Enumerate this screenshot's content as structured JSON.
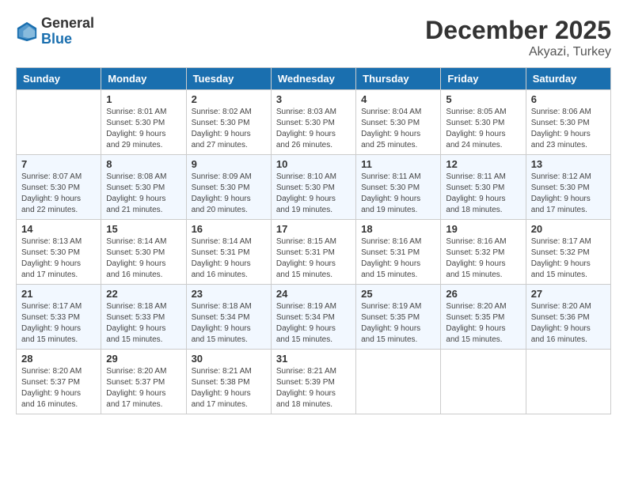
{
  "header": {
    "logo_line1": "General",
    "logo_line2": "Blue",
    "month": "December 2025",
    "location": "Akyazi, Turkey"
  },
  "weekdays": [
    "Sunday",
    "Monday",
    "Tuesday",
    "Wednesday",
    "Thursday",
    "Friday",
    "Saturday"
  ],
  "weeks": [
    [
      {
        "day": "",
        "sunrise": "",
        "sunset": "",
        "daylight": ""
      },
      {
        "day": "1",
        "sunrise": "Sunrise: 8:01 AM",
        "sunset": "Sunset: 5:30 PM",
        "daylight": "Daylight: 9 hours and 29 minutes."
      },
      {
        "day": "2",
        "sunrise": "Sunrise: 8:02 AM",
        "sunset": "Sunset: 5:30 PM",
        "daylight": "Daylight: 9 hours and 27 minutes."
      },
      {
        "day": "3",
        "sunrise": "Sunrise: 8:03 AM",
        "sunset": "Sunset: 5:30 PM",
        "daylight": "Daylight: 9 hours and 26 minutes."
      },
      {
        "day": "4",
        "sunrise": "Sunrise: 8:04 AM",
        "sunset": "Sunset: 5:30 PM",
        "daylight": "Daylight: 9 hours and 25 minutes."
      },
      {
        "day": "5",
        "sunrise": "Sunrise: 8:05 AM",
        "sunset": "Sunset: 5:30 PM",
        "daylight": "Daylight: 9 hours and 24 minutes."
      },
      {
        "day": "6",
        "sunrise": "Sunrise: 8:06 AM",
        "sunset": "Sunset: 5:30 PM",
        "daylight": "Daylight: 9 hours and 23 minutes."
      }
    ],
    [
      {
        "day": "7",
        "sunrise": "Sunrise: 8:07 AM",
        "sunset": "Sunset: 5:30 PM",
        "daylight": "Daylight: 9 hours and 22 minutes."
      },
      {
        "day": "8",
        "sunrise": "Sunrise: 8:08 AM",
        "sunset": "Sunset: 5:30 PM",
        "daylight": "Daylight: 9 hours and 21 minutes."
      },
      {
        "day": "9",
        "sunrise": "Sunrise: 8:09 AM",
        "sunset": "Sunset: 5:30 PM",
        "daylight": "Daylight: 9 hours and 20 minutes."
      },
      {
        "day": "10",
        "sunrise": "Sunrise: 8:10 AM",
        "sunset": "Sunset: 5:30 PM",
        "daylight": "Daylight: 9 hours and 19 minutes."
      },
      {
        "day": "11",
        "sunrise": "Sunrise: 8:11 AM",
        "sunset": "Sunset: 5:30 PM",
        "daylight": "Daylight: 9 hours and 19 minutes."
      },
      {
        "day": "12",
        "sunrise": "Sunrise: 8:11 AM",
        "sunset": "Sunset: 5:30 PM",
        "daylight": "Daylight: 9 hours and 18 minutes."
      },
      {
        "day": "13",
        "sunrise": "Sunrise: 8:12 AM",
        "sunset": "Sunset: 5:30 PM",
        "daylight": "Daylight: 9 hours and 17 minutes."
      }
    ],
    [
      {
        "day": "14",
        "sunrise": "Sunrise: 8:13 AM",
        "sunset": "Sunset: 5:30 PM",
        "daylight": "Daylight: 9 hours and 17 minutes."
      },
      {
        "day": "15",
        "sunrise": "Sunrise: 8:14 AM",
        "sunset": "Sunset: 5:30 PM",
        "daylight": "Daylight: 9 hours and 16 minutes."
      },
      {
        "day": "16",
        "sunrise": "Sunrise: 8:14 AM",
        "sunset": "Sunset: 5:31 PM",
        "daylight": "Daylight: 9 hours and 16 minutes."
      },
      {
        "day": "17",
        "sunrise": "Sunrise: 8:15 AM",
        "sunset": "Sunset: 5:31 PM",
        "daylight": "Daylight: 9 hours and 15 minutes."
      },
      {
        "day": "18",
        "sunrise": "Sunrise: 8:16 AM",
        "sunset": "Sunset: 5:31 PM",
        "daylight": "Daylight: 9 hours and 15 minutes."
      },
      {
        "day": "19",
        "sunrise": "Sunrise: 8:16 AM",
        "sunset": "Sunset: 5:32 PM",
        "daylight": "Daylight: 9 hours and 15 minutes."
      },
      {
        "day": "20",
        "sunrise": "Sunrise: 8:17 AM",
        "sunset": "Sunset: 5:32 PM",
        "daylight": "Daylight: 9 hours and 15 minutes."
      }
    ],
    [
      {
        "day": "21",
        "sunrise": "Sunrise: 8:17 AM",
        "sunset": "Sunset: 5:33 PM",
        "daylight": "Daylight: 9 hours and 15 minutes."
      },
      {
        "day": "22",
        "sunrise": "Sunrise: 8:18 AM",
        "sunset": "Sunset: 5:33 PM",
        "daylight": "Daylight: 9 hours and 15 minutes."
      },
      {
        "day": "23",
        "sunrise": "Sunrise: 8:18 AM",
        "sunset": "Sunset: 5:34 PM",
        "daylight": "Daylight: 9 hours and 15 minutes."
      },
      {
        "day": "24",
        "sunrise": "Sunrise: 8:19 AM",
        "sunset": "Sunset: 5:34 PM",
        "daylight": "Daylight: 9 hours and 15 minutes."
      },
      {
        "day": "25",
        "sunrise": "Sunrise: 8:19 AM",
        "sunset": "Sunset: 5:35 PM",
        "daylight": "Daylight: 9 hours and 15 minutes."
      },
      {
        "day": "26",
        "sunrise": "Sunrise: 8:20 AM",
        "sunset": "Sunset: 5:35 PM",
        "daylight": "Daylight: 9 hours and 15 minutes."
      },
      {
        "day": "27",
        "sunrise": "Sunrise: 8:20 AM",
        "sunset": "Sunset: 5:36 PM",
        "daylight": "Daylight: 9 hours and 16 minutes."
      }
    ],
    [
      {
        "day": "28",
        "sunrise": "Sunrise: 8:20 AM",
        "sunset": "Sunset: 5:37 PM",
        "daylight": "Daylight: 9 hours and 16 minutes."
      },
      {
        "day": "29",
        "sunrise": "Sunrise: 8:20 AM",
        "sunset": "Sunset: 5:37 PM",
        "daylight": "Daylight: 9 hours and 17 minutes."
      },
      {
        "day": "30",
        "sunrise": "Sunrise: 8:21 AM",
        "sunset": "Sunset: 5:38 PM",
        "daylight": "Daylight: 9 hours and 17 minutes."
      },
      {
        "day": "31",
        "sunrise": "Sunrise: 8:21 AM",
        "sunset": "Sunset: 5:39 PM",
        "daylight": "Daylight: 9 hours and 18 minutes."
      },
      {
        "day": "",
        "sunrise": "",
        "sunset": "",
        "daylight": ""
      },
      {
        "day": "",
        "sunrise": "",
        "sunset": "",
        "daylight": ""
      },
      {
        "day": "",
        "sunrise": "",
        "sunset": "",
        "daylight": ""
      }
    ]
  ]
}
